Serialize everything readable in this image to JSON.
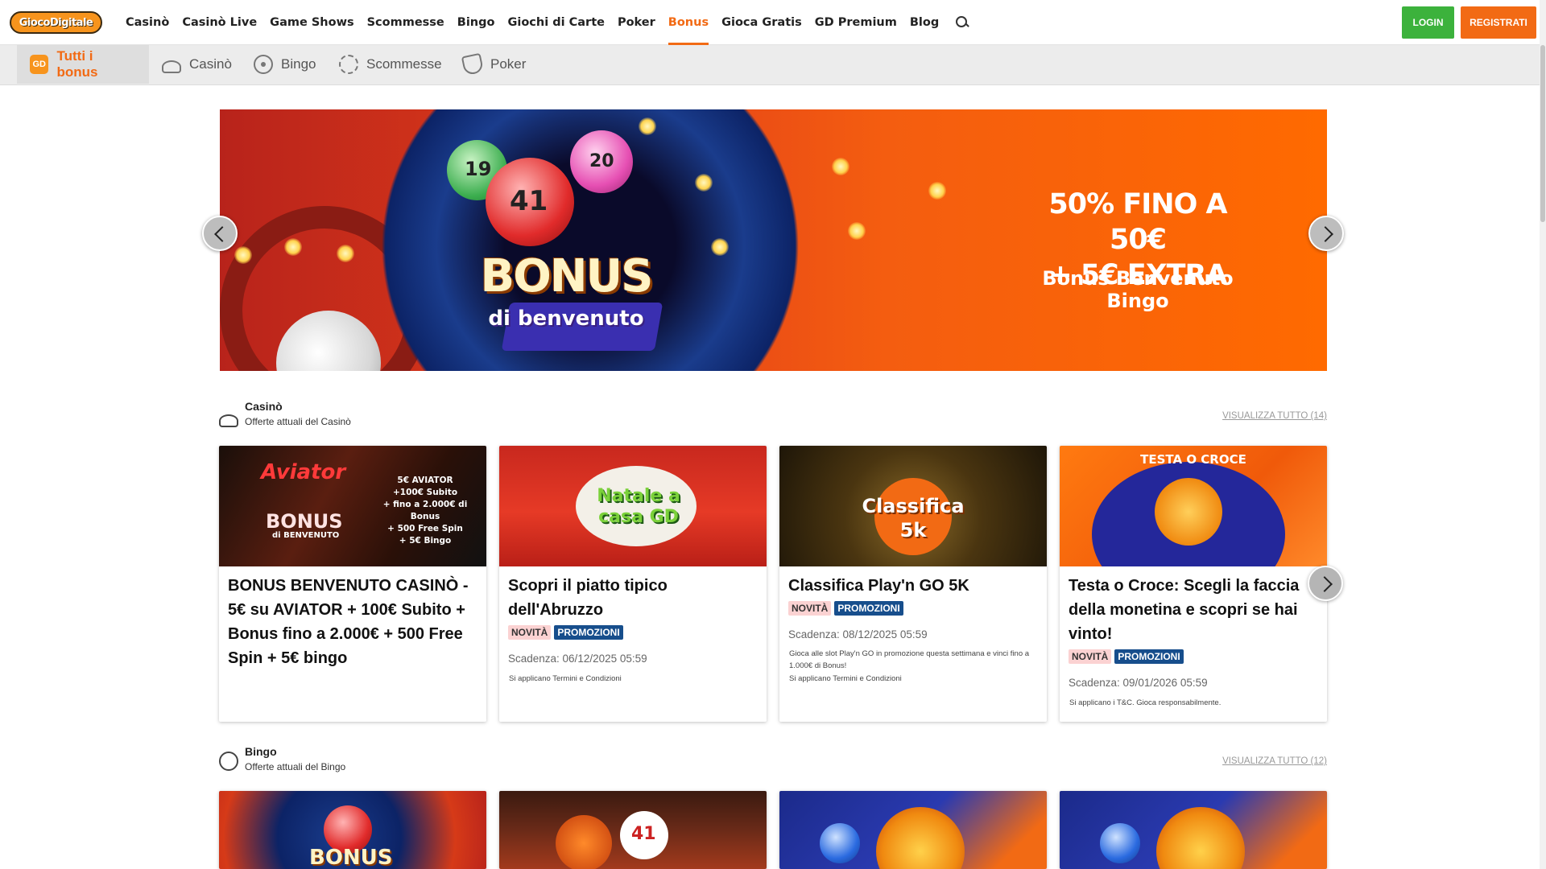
{
  "header": {
    "logo_text": "GiocoDigitale",
    "nav": [
      "Casinò",
      "Casinò Live",
      "Game Shows",
      "Scommesse",
      "Bingo",
      "Giochi di Carte",
      "Poker",
      "Bonus",
      "Gioca Gratis",
      "GD Premium",
      "Blog"
    ],
    "active_nav": "Bonus",
    "login_label": "LOGIN",
    "register_label": "REGISTRATI"
  },
  "categories": {
    "items": [
      "Tutti i bonus",
      "Casinò",
      "Bingo",
      "Scommesse",
      "Poker"
    ],
    "active": "Tutti i bonus",
    "gd_icon_text": "GD"
  },
  "hero": {
    "bonus_word": "BONUS",
    "bonus_sub": "di benvenuto",
    "headline_line1": "50% FINO A 50€",
    "headline_line2": "+ 5€ EXTRA",
    "tagline": "Bonus Benvenuto Bingo",
    "ball_numbers": [
      "19",
      "41",
      "20"
    ]
  },
  "sections": {
    "casino": {
      "title": "Casinò",
      "subtitle": "Offerte attuali del Casinò",
      "see_all": "VISUALIZZA TUTTO (14)",
      "cards": [
        {
          "image_title": "Aviator",
          "image_bonus": "BONUS",
          "image_bonus_sub": "di BENVENUTO",
          "image_lines": [
            "5€ AVIATOR",
            "+100€ Subito",
            "+ fino a 2.000€ di Bonus",
            "+ 500 Free Spin",
            "+ 5€ Bingo"
          ],
          "title": "BONUS BENVENUTO CASINÒ - 5€ su AVIATOR + 100€ Subito + Bonus fino a 2.000€ + 500 Free Spin + 5€ bingo"
        },
        {
          "image_title": "Natale a casa GD",
          "title": "Scopri il piatto tipico dell'Abruzzo",
          "badges": [
            "NOVITÀ",
            "PROMOZIONI"
          ],
          "deadline": "Scadenza: 06/12/2025 05:59",
          "note": "Si applicano Termini e Condizioni"
        },
        {
          "image_title": "Classifica 5k",
          "title": "Classifica Play'n GO 5K",
          "badges": [
            "NOVITÀ",
            "PROMOZIONI"
          ],
          "deadline": "Scadenza: 08/12/2025 05:59",
          "note": "Gioca alle slot Play'n GO in promozione questa settimana e vinci fino a 1.000€ di Bonus!",
          "note2": "Si applicano Termini e Condizioni"
        },
        {
          "image_title": "TESTA O CROCE",
          "title": "Testa o Croce: Scegli la faccia della monetina e scopri se hai vinto!",
          "badges": [
            "NOVITÀ",
            "PROMOZIONI"
          ],
          "deadline": "Scadenza: 09/01/2026 05:59",
          "note": "Si applicano i T&C. Gioca responsabilmente."
        }
      ]
    },
    "bingo": {
      "title": "Bingo",
      "subtitle": "Offerte attuali del Bingo",
      "see_all": "VISUALIZZA TUTTO (12)",
      "card_image_texts": [
        "BONUS",
        "41"
      ]
    }
  },
  "colors": {
    "brand_orange": "#f26a14",
    "login_green": "#3cb23c",
    "promo_blue": "#174e8c",
    "new_pink": "#fbd2d2"
  },
  "icons": {
    "search": "search-icon",
    "casino": "roulette-icon",
    "bingo": "bingo-ball-icon",
    "bets": "balls-icon",
    "poker": "poker-shield-icon"
  }
}
